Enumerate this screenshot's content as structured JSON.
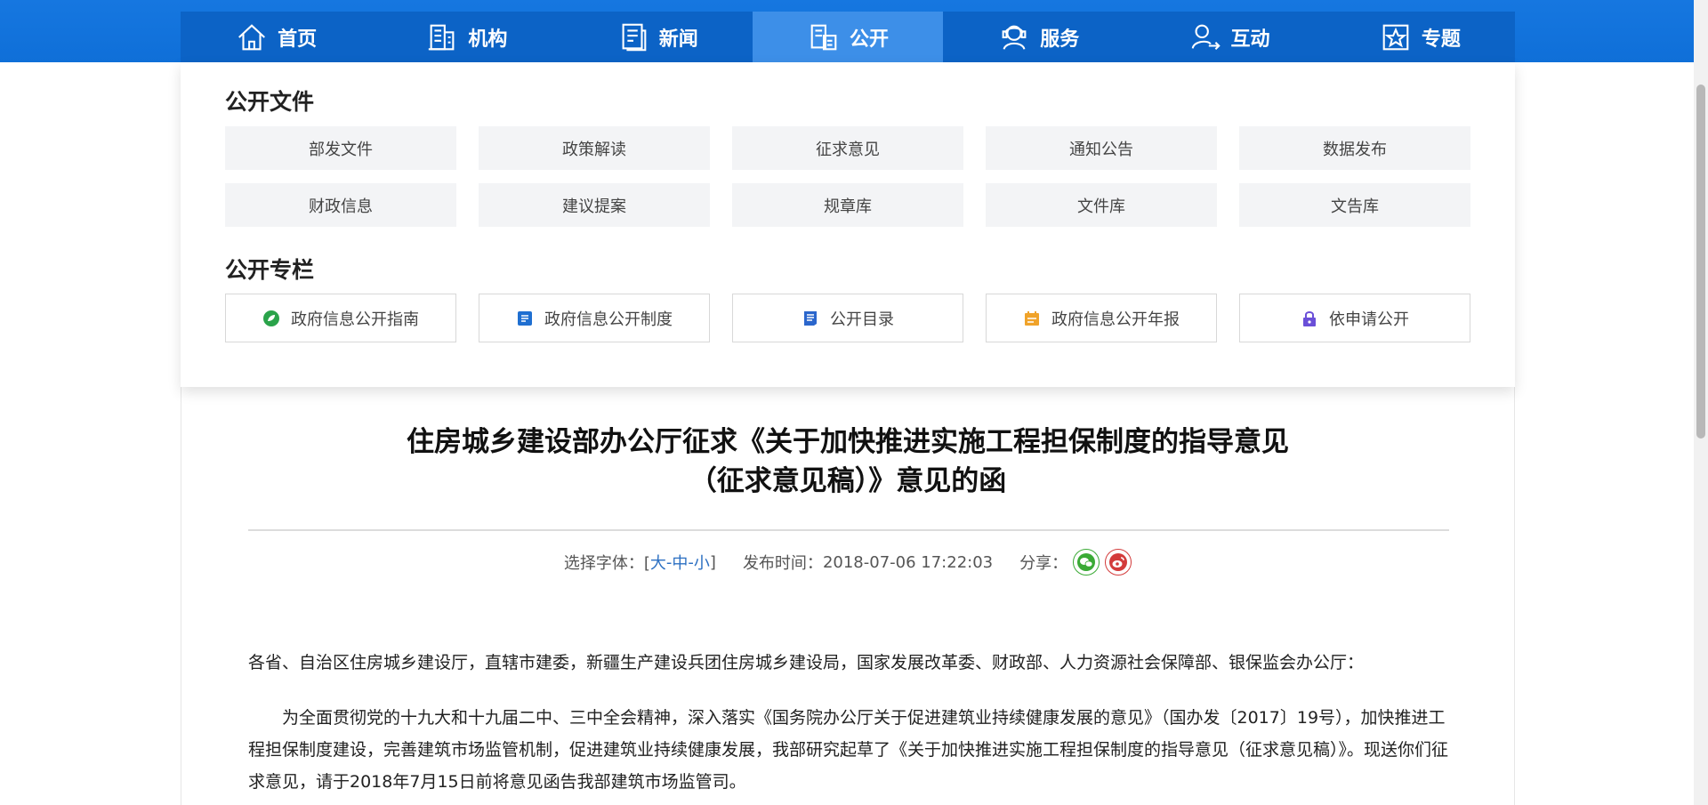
{
  "nav": {
    "items": [
      {
        "label": "首页",
        "icon": "home-icon"
      },
      {
        "label": "机构",
        "icon": "building-icon"
      },
      {
        "label": "新闻",
        "icon": "news-icon"
      },
      {
        "label": "公开",
        "icon": "disclosure-icon"
      },
      {
        "label": "服务",
        "icon": "service-icon"
      },
      {
        "label": "互动",
        "icon": "interact-icon"
      },
      {
        "label": "专题",
        "icon": "star-icon"
      }
    ],
    "active": "公开"
  },
  "panel": {
    "files_title": "公开文件",
    "files": [
      "部发文件",
      "政策解读",
      "征求意见",
      "通知公告",
      "数据发布",
      "财政信息",
      "建议提案",
      "规章库",
      "文件库",
      "文告库"
    ],
    "columns_title": "公开专栏",
    "columns": [
      {
        "label": "政府信息公开指南",
        "icon": "leaf-icon",
        "color": "#2aa34a"
      },
      {
        "label": "政府信息公开制度",
        "icon": "document-icon",
        "color": "#1f6fd1"
      },
      {
        "label": "公开目录",
        "icon": "list-icon",
        "color": "#2b66cc"
      },
      {
        "label": "政府信息公开年报",
        "icon": "calendar-icon",
        "color": "#f0a32a"
      },
      {
        "label": "依申请公开",
        "icon": "lock-icon",
        "color": "#6a4fd8"
      }
    ]
  },
  "article": {
    "title_line1": "住房城乡建设部办公厅征求《关于加快推进实施工程担保制度的指导意见",
    "title_line2": "（征求意见稿）》意见的函",
    "meta": {
      "font_label": "选择字体：[",
      "font_large": "大",
      "font_medium": "中",
      "font_small": "小",
      "sep": "-",
      "font_close": "]",
      "publish_label": "发布时间：",
      "publish_time": "2018-07-06 17:22:03",
      "share_label": "分享："
    },
    "para1": "各省、自治区住房城乡建设厅，直辖市建委，新疆生产建设兵团住房城乡建设局，国家发展改革委、财政部、人力资源社会保障部、银保监会办公厅：",
    "para2": "为全面贯彻党的十九大和十九届二中、三中全会精神，深入落实《国务院办公厅关于促进建筑业持续健康发展的意见》（国办发〔2017〕19号），加快推进工程担保制度建设，完善建筑市场监管机制，促进建筑业持续健康发展，我部研究起草了《关于加快推进实施工程担保制度的指导意见（征求意见稿）》。现送你们征求意见，请于2018年7月15日前将意见函告我部建筑市场监管司。"
  },
  "colors": {
    "nav_bg": "#0c63c6",
    "nav_active": "#3d8fe8",
    "link": "#2b6fc2"
  }
}
